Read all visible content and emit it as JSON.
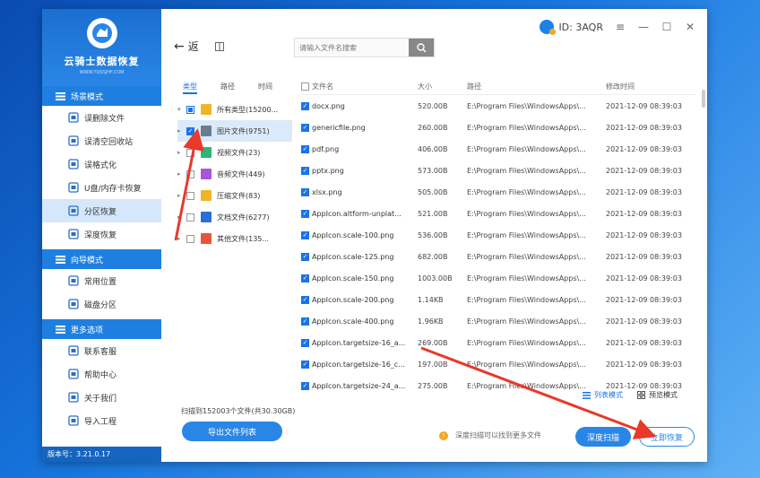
{
  "app": {
    "logo_title": "云骑士数据恢复",
    "logo_sub": "WWW.YQSSJHF.COM",
    "version": "版本号：3.21.0.17"
  },
  "user": {
    "id": "ID: 3AQR"
  },
  "window_controls": {
    "menu": "≡",
    "minimize": "—",
    "maximize": "☐",
    "close": "✕"
  },
  "sidebar": {
    "sections": [
      {
        "title": "场景模式",
        "items": [
          {
            "label": "误删除文件",
            "icon": "file-delete-icon"
          },
          {
            "label": "误清空回收站",
            "icon": "recycle-bin-icon"
          },
          {
            "label": "误格式化",
            "icon": "format-icon"
          },
          {
            "label": "U盘/内存卡恢复",
            "icon": "usb-icon"
          },
          {
            "label": "分区恢复",
            "icon": "partition-icon",
            "active": true
          },
          {
            "label": "深度恢复",
            "icon": "deep-recover-icon"
          }
        ]
      },
      {
        "title": "向导模式",
        "items": [
          {
            "label": "常用位置",
            "icon": "location-icon"
          },
          {
            "label": "磁盘分区",
            "icon": "disk-icon"
          }
        ]
      },
      {
        "title": "更多选项",
        "items": [
          {
            "label": "联系客服",
            "icon": "customer-service-icon"
          },
          {
            "label": "帮助中心",
            "icon": "help-icon"
          },
          {
            "label": "关于我们",
            "icon": "info-icon"
          },
          {
            "label": "导入工程",
            "icon": "import-icon"
          }
        ]
      }
    ]
  },
  "toolbar": {
    "back": "返",
    "search_placeholder": "请输入文件名搜索"
  },
  "tree": {
    "tabs": [
      "类型",
      "路径",
      "时间"
    ],
    "root": "所有类型(15200...",
    "items": [
      {
        "label": "图片文件(9751)",
        "color": "#6b7c8f",
        "checked": true,
        "selected": true
      },
      {
        "label": "视频文件(23)",
        "color": "#2bb673"
      },
      {
        "label": "音频文件(449)",
        "color": "#a855d8"
      },
      {
        "label": "压缩文件(83)",
        "color": "#f0b429"
      },
      {
        "label": "文档文件(6277)",
        "color": "#2b6fd6"
      },
      {
        "label": "其他文件(135...",
        "color": "#e8543a"
      }
    ]
  },
  "table": {
    "headers": [
      "文件名",
      "大小",
      "路径",
      "修改时间"
    ],
    "rows": [
      [
        "docx.png",
        "520.00B",
        "E:\\Program Files\\WindowsApps\\...",
        "2021-12-09 08:39:03"
      ],
      [
        "genericfile.png",
        "260.00B",
        "E:\\Program Files\\WindowsApps\\...",
        "2021-12-09 08:39:03"
      ],
      [
        "pdf.png",
        "406.00B",
        "E:\\Program Files\\WindowsApps\\...",
        "2021-12-09 08:39:03"
      ],
      [
        "pptx.png",
        "573.00B",
        "E:\\Program Files\\WindowsApps\\...",
        "2021-12-09 08:39:03"
      ],
      [
        "xlsx.png",
        "505.00B",
        "E:\\Program Files\\WindowsApps\\...",
        "2021-12-09 08:39:03"
      ],
      [
        "AppIcon.altform-unplat...",
        "521.00B",
        "E:\\Program Files\\WindowsApps\\...",
        "2021-12-09 08:39:03"
      ],
      [
        "AppIcon.scale-100.png",
        "536.00B",
        "E:\\Program Files\\WindowsApps\\...",
        "2021-12-09 08:39:03"
      ],
      [
        "AppIcon.scale-125.png",
        "682.00B",
        "E:\\Program Files\\WindowsApps\\...",
        "2021-12-09 08:39:03"
      ],
      [
        "AppIcon.scale-150.png",
        "1003.00B",
        "E:\\Program Files\\WindowsApps\\...",
        "2021-12-09 08:39:03"
      ],
      [
        "AppIcon.scale-200.png",
        "1.14KB",
        "E:\\Program Files\\WindowsApps\\...",
        "2021-12-09 08:39:03"
      ],
      [
        "AppIcon.scale-400.png",
        "1.96KB",
        "E:\\Program Files\\WindowsApps\\...",
        "2021-12-09 08:39:03"
      ],
      [
        "AppIcon.targetsize-16_a...",
        "269.00B",
        "E:\\Program Files\\WindowsApps\\...",
        "2021-12-09 08:39:03"
      ],
      [
        "AppIcon.targetsize-16_c...",
        "197.00B",
        "E:\\Program Files\\WindowsApps\\...",
        "2021-12-09 08:39:03"
      ],
      [
        "AppIcon.targetsize-24_a...",
        "275.00B",
        "E:\\Program Files\\WindowsApps\\...",
        "2021-12-09 08:39:03"
      ]
    ]
  },
  "view_modes": {
    "list": "列表模式",
    "preview": "预览模式"
  },
  "footer": {
    "scan_info": "扫描到152003个文件(共30.30GB)",
    "export": "导出文件列表",
    "hint": "深度扫描可以找到更多文件",
    "deep_scan": "深度扫描",
    "recover": "立即恢复"
  },
  "colors": {
    "accent": "#2a86e6",
    "sidebar_head": "#1f7fe0",
    "annotation": "#e8392b"
  }
}
